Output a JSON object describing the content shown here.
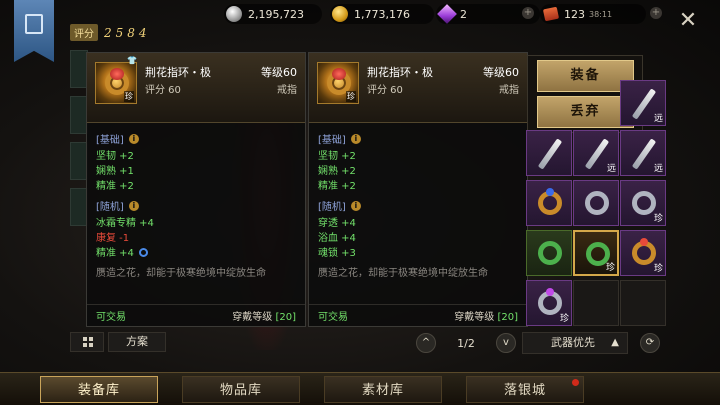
{
  "topbar": {
    "silver": "2,195,723",
    "gold": "1,773,176",
    "gems": "2",
    "tickets": "123",
    "timer": "38:11",
    "plus": "+"
  },
  "rating": {
    "label": "评分",
    "value": "2584"
  },
  "tooltips": [
    {
      "name": "荆花指环・极",
      "score": "评分 60",
      "level": "等级60",
      "slot_type": "戒指",
      "icon_level": "珍",
      "base_title": "[基础]",
      "base_stats": [
        "坚韧 +2",
        "娴熟 +1",
        "精准 +2"
      ],
      "random_title": "[随机]",
      "random_stats": [
        "冰霜专精 +4",
        "康复 -1",
        "精准 +4"
      ],
      "description": "赝造之花，却能于极寒绝境中绽放生命",
      "tradable": "可交易",
      "req_label": "穿戴等级",
      "req_value": "[20]"
    },
    {
      "name": "荆花指环・极",
      "score": "评分 60",
      "level": "等级60",
      "slot_type": "戒指",
      "icon_level": "珍",
      "base_title": "[基础]",
      "base_stats": [
        "坚韧 +2",
        "娴熟 +2",
        "精准 +2"
      ],
      "random_title": "[随机]",
      "random_stats": [
        "穿透 +4",
        "浴血 +4",
        "魂锁 +3"
      ],
      "description": "赝造之花，却能于极寒绝境中绽放生命",
      "tradable": "可交易",
      "req_label": "穿戴等级",
      "req_value": "[20]"
    }
  ],
  "actions": {
    "equip": "装备",
    "discard": "丢弃"
  },
  "inventory_tags": {
    "far": "远",
    "rare": "珍"
  },
  "controls": {
    "plan": "方案",
    "page": "1/2",
    "sort": "武器优先",
    "up": "^",
    "down": "v"
  },
  "tabs": [
    "装备库",
    "物品库",
    "素材库",
    "落银城"
  ],
  "colors": {
    "accent": "#c9a45a",
    "green_stat": "#72e06a",
    "red_stat": "#e84a3a"
  }
}
